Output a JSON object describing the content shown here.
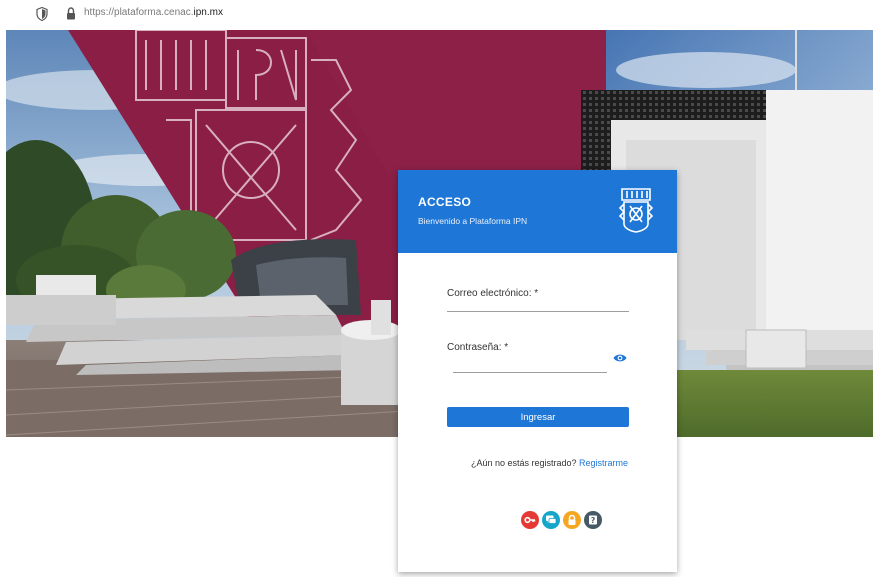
{
  "browser": {
    "url_prefix": "https://plataforma.cenac.",
    "url_domain": "ipn.mx"
  },
  "login": {
    "title": "ACCESO",
    "subtitle": "Bienvenido a Plataforma IPN",
    "email_label": "Correo electrónico: *",
    "email_value": "",
    "password_label": "Contraseña: *",
    "password_value": "",
    "submit_label": "Ingresar",
    "register_prompt": "¿Aún no estás registrado?",
    "register_link": "Registrarme"
  },
  "footer_icons": [
    {
      "name": "key-icon",
      "color": "#e53935"
    },
    {
      "name": "chat-icon",
      "color": "#17a5c9"
    },
    {
      "name": "lock-icon",
      "color": "#f5a623"
    },
    {
      "name": "help-icon",
      "color": "#455a64"
    }
  ],
  "colors": {
    "primary": "#1e76d6",
    "brand_maroon": "#8b1e45"
  }
}
